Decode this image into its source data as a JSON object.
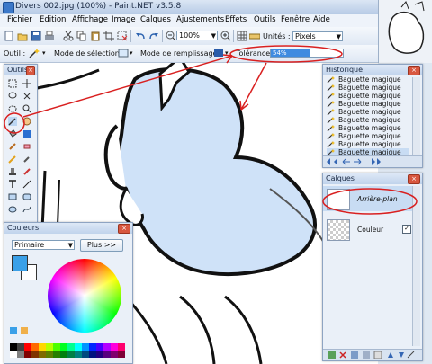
{
  "window": {
    "title": "Divers 002.jpg (100%) - Paint.NET v3.5.8"
  },
  "menu": [
    "Fichier",
    "Edition",
    "Affichage",
    "Image",
    "Calques",
    "Ajustements",
    "Effets",
    "Outils",
    "Fenêtre",
    "Aide"
  ],
  "toolbar": {
    "zoom_value": "100%",
    "units_label": "Unités :",
    "units_value": "Pixels"
  },
  "options_bar": {
    "tool_label": "Outil :",
    "selection_mode_label": "Mode de sélection :",
    "fill_mode_label": "Mode de remplissage :",
    "tolerance_label": "Tolérance :",
    "tolerance_value": "54%",
    "tolerance_fraction": 0.54
  },
  "tools_palette": {
    "title": "Outils"
  },
  "history_palette": {
    "title": "Historique",
    "items": [
      "Baguette magique",
      "Baguette magique",
      "Baguette magique",
      "Baguette magique",
      "Baguette magique",
      "Baguette magique",
      "Baguette magique",
      "Baguette magique",
      "Baguette magique",
      "Baguette magique"
    ],
    "selected_index": 9
  },
  "layers_palette": {
    "title": "Calques",
    "layers": [
      "Arrière-plan",
      "Couleur"
    ]
  },
  "colors_palette": {
    "title": "Couleurs",
    "mode_value": "Primaire",
    "more_button": "Plus >>",
    "primary_color": "#3aa0e8",
    "secondary_color": "#ffffff"
  },
  "colors": {
    "annotation_red": "#d92020",
    "fill_blue": "#cfe2f8"
  }
}
